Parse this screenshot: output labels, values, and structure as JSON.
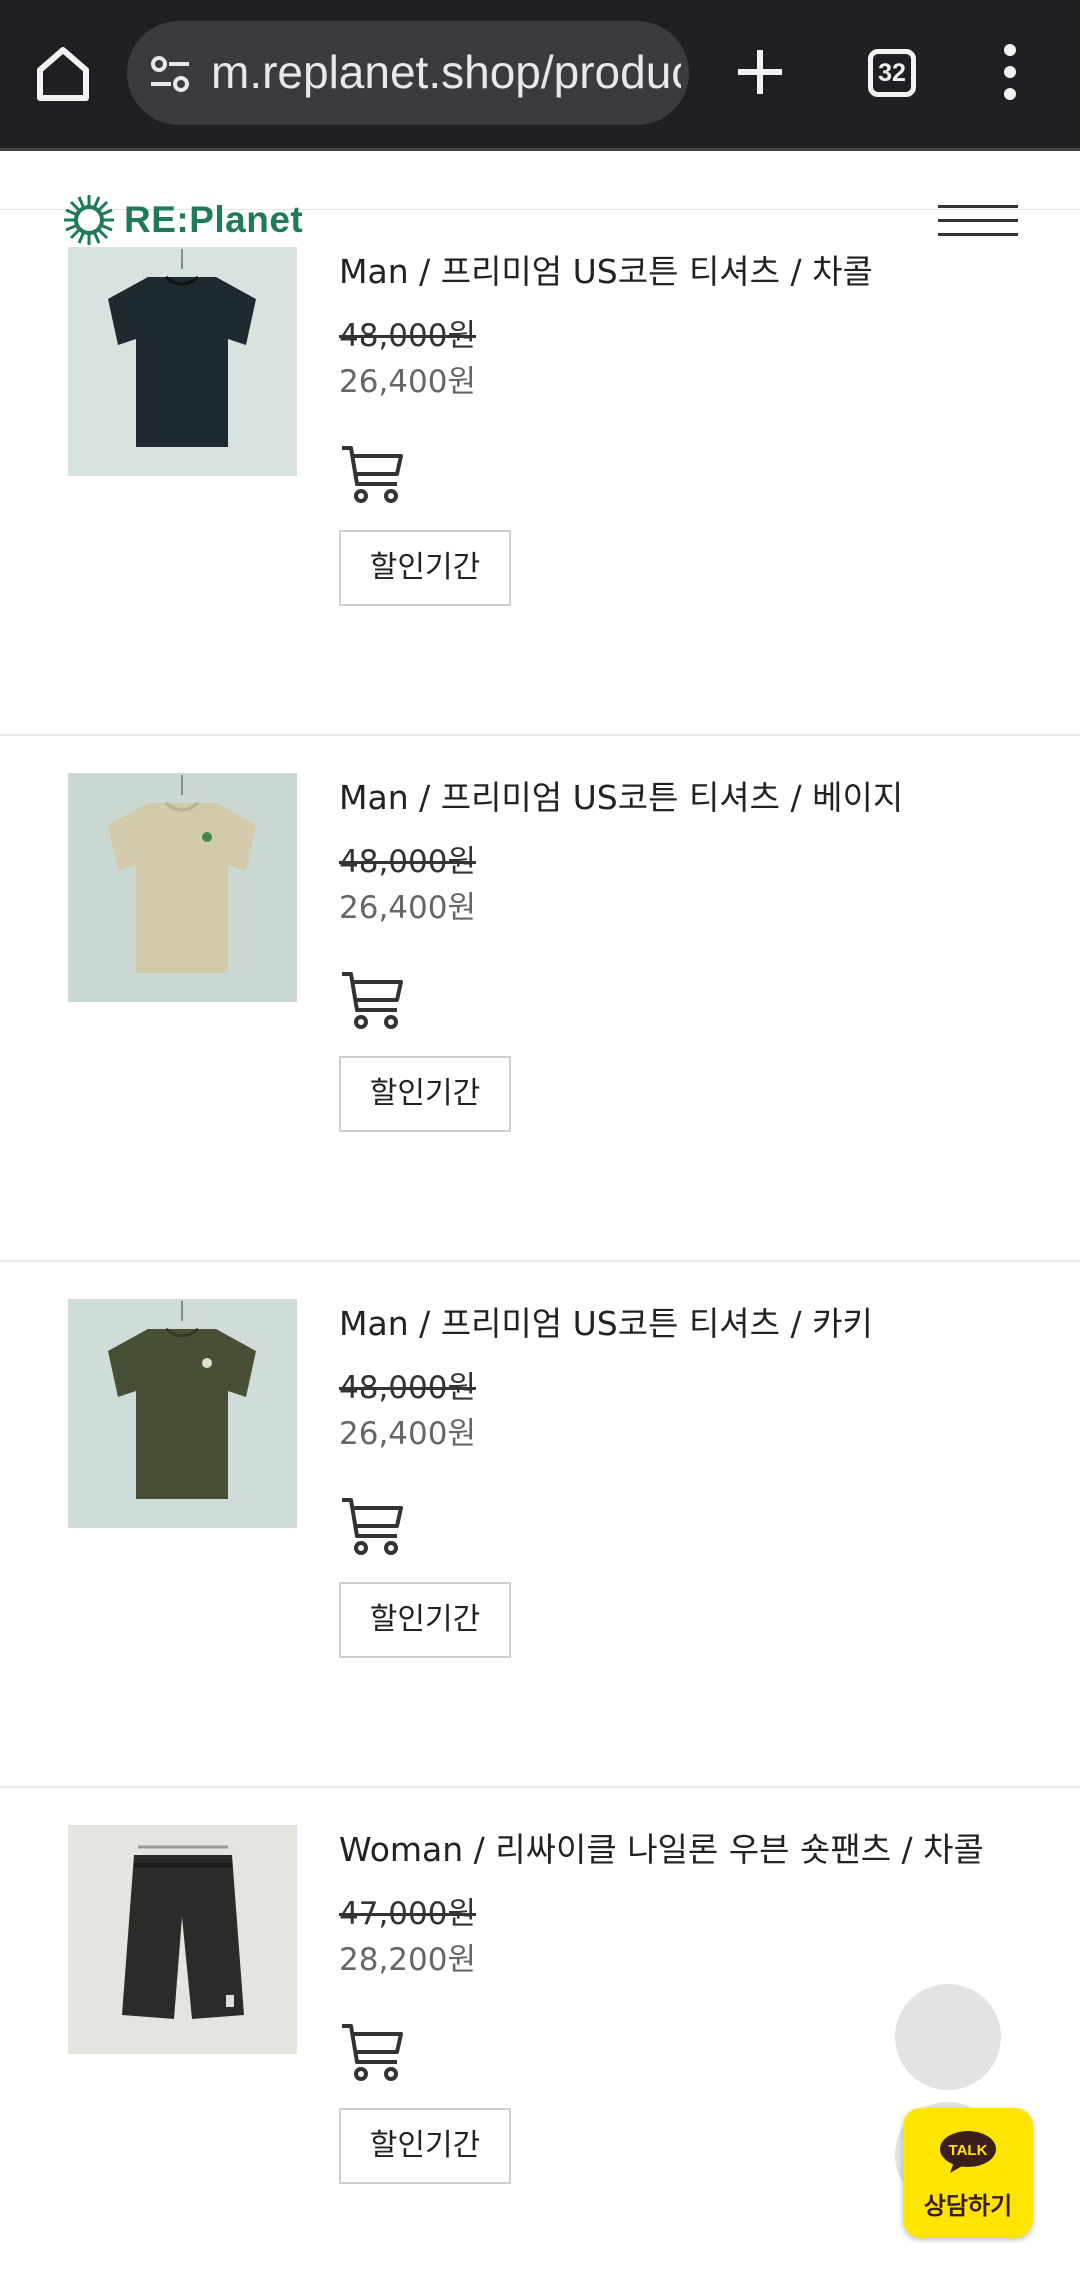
{
  "browser": {
    "url": "m.replanet.shop/product",
    "tab_count": "32"
  },
  "site": {
    "logo_text": "RE:Planet"
  },
  "products": [
    {
      "title": "Man / 프리미엄 US코튼 티셔츠 / 차콜",
      "original_price": "48,000원",
      "sale_price": "26,400원",
      "button": "할인기간",
      "shirt_color": "#1f2a30"
    },
    {
      "title": "Man / 프리미엄 US코튼 티셔츠 / 베이지",
      "original_price": "48,000원",
      "sale_price": "26,400원",
      "button": "할인기간",
      "shirt_color": "#d3c9ab"
    },
    {
      "title": "Man / 프리미엄 US코튼 티셔츠 / 카키",
      "original_price": "48,000원",
      "sale_price": "26,400원",
      "button": "할인기간",
      "shirt_color": "#474f37"
    },
    {
      "title": "Woman / 리싸이클 나일론 우븐 숏팬츠 / 차콜",
      "original_price": "47,000원",
      "sale_price": "28,200원",
      "button": "할인기간",
      "shirt_color": "#2a2c2a"
    }
  ],
  "kakao": {
    "badge": "TALK",
    "label": "상담하기"
  }
}
